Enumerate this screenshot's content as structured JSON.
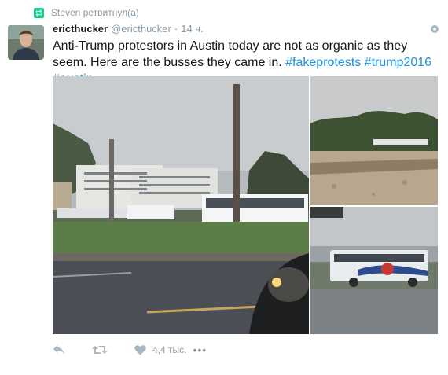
{
  "retweet": {
    "text": "Steven ретвитнул(а)",
    "icon": "retweet-icon"
  },
  "tweet": {
    "name": "ericthucker",
    "handle": "@ericthucker",
    "dot": "·",
    "time": "14 ч.",
    "text": "Anti-Trump protestors in Austin today are not as organic as they seem. Here are the busses they came in.",
    "hashtags": [
      "#fakeprotests",
      "#trump2016",
      "#austin"
    ]
  },
  "actions": {
    "reply_icon": "reply-icon",
    "retweet_icon": "retweet-icon",
    "like_icon": "heart-icon",
    "like_count": "4,4 тыс.",
    "more_icon": "•••"
  },
  "colors": {
    "link": "#1b95e0",
    "muted": "#8899a6",
    "retweet_green": "#19cf86"
  }
}
